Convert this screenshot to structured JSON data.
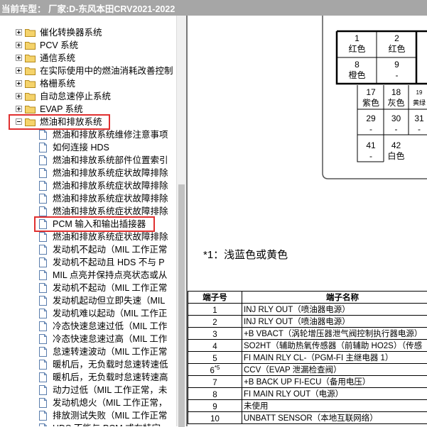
{
  "title_bar": {
    "text": "当前车型：  厂家:D-东风本田CRV2021-2022"
  },
  "tree": {
    "folders": [
      {
        "label": "催化转换器系统",
        "expanded": false
      },
      {
        "label": "PCV 系统",
        "expanded": false
      },
      {
        "label": "通信系统",
        "expanded": false
      },
      {
        "label": "在实际使用中的燃油消耗改善控制",
        "expanded": false
      },
      {
        "label": "格栅系统",
        "expanded": false
      },
      {
        "label": "自动怠速停止系统",
        "expanded": false
      },
      {
        "label": "EVAP 系统",
        "expanded": false
      },
      {
        "label": "燃油和排放系统",
        "expanded": true
      }
    ],
    "children": [
      "燃油和排放系统维修注意事项",
      "如何连接 HDS",
      "燃油和排放系统部件位置索引",
      "燃油和排放系统症状故障排除",
      "燃油和排放系统症状故障排除",
      "燃油和排放系统症状故障排除",
      "燃油和排放系统症状故障排除",
      "PCM 输入和输出插接器",
      "燃油和排放系统症状故障排除",
      "发动机不起动（MIL 工作正常",
      "发动机不起动且 HDS 不与 P",
      "MIL 点亮并保持点亮状态或从",
      "发动机不起动（MIL 工作正常",
      "发动机起动但立即失速（MIL",
      "发动机难以起动（MIL 工作正",
      "冷态快速怠速过低（MIL 工作",
      "冷态快速怠速过高（MIL 工作",
      "怠速转速波动（MIL 工作正常",
      "暖机后，无负载时怠速转速低",
      "暖机后，无负载时怠速转速高",
      "动力过低（MIL 工作正常，未",
      "发动机熄火（MIL 工作正常，",
      "排放测试失败（MIL 工作正常",
      "HDS 不能与 PCM 或在特定"
    ]
  },
  "connector": {
    "pins": [
      {
        "num": "1",
        "color": "红色"
      },
      {
        "num": "2",
        "color": "红色"
      },
      {
        "num": "8",
        "color": "橙色"
      },
      {
        "num": "9",
        "color": "-"
      },
      {
        "num": "17",
        "color": "紫色"
      },
      {
        "num": "18",
        "color": "灰色"
      },
      {
        "num": "19",
        "color": "黄绿"
      },
      {
        "num": "29",
        "color": "-"
      },
      {
        "num": "30",
        "color": "-"
      },
      {
        "num": "31",
        "color": "-"
      },
      {
        "num": "41",
        "color": "-"
      },
      {
        "num": "42",
        "color": "白色"
      }
    ]
  },
  "note": "*1：浅蓝色或黄色",
  "pin_table": {
    "headers": [
      "端子号",
      "端子名称"
    ],
    "rows": [
      {
        "num": "1",
        "sup": "",
        "name": "INJ RLY OUT（喷油器电源）"
      },
      {
        "num": "2",
        "sup": "",
        "name": "INJ RLY OUT（喷油器电源）"
      },
      {
        "num": "3",
        "sup": "",
        "name": "+B VBACT（涡轮增压器泄气阀控制执行器电源）"
      },
      {
        "num": "4",
        "sup": "",
        "name": "SO2HT（辅助热氧传感器（前辅助 HO2S）（传感"
      },
      {
        "num": "5",
        "sup": "",
        "name": "FI MAIN RLY CL-（PGM-FI 主继电器 1）"
      },
      {
        "num": "6",
        "sup": "*5",
        "name": "CCV（EVAP 泄漏检查阀）"
      },
      {
        "num": "7",
        "sup": "",
        "name": "+B BACK UP FI-ECU（备用电压）"
      },
      {
        "num": "8",
        "sup": "",
        "name": "FI MAIN RLY OUT（电源）"
      },
      {
        "num": "9",
        "sup": "",
        "name": "未使用"
      },
      {
        "num": "10",
        "sup": "",
        "name": "UNBATT SENSOR（本地互联网络）"
      }
    ]
  }
}
